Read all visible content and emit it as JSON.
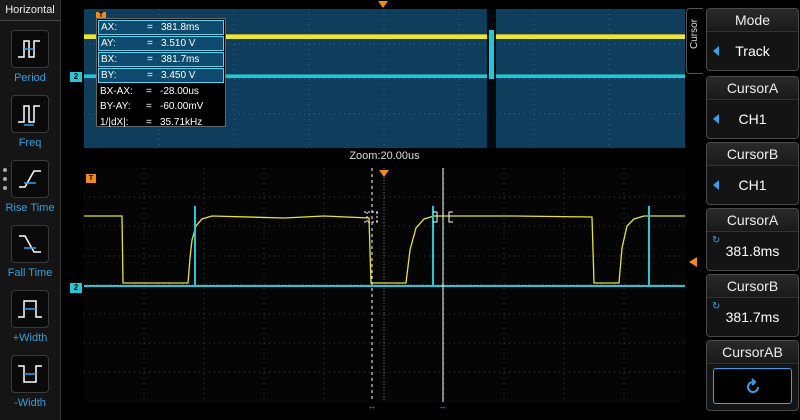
{
  "sidebar": {
    "title": "Horizontal",
    "items": [
      {
        "label": "Period",
        "icon": "period-icon"
      },
      {
        "label": "Freq",
        "icon": "frequency-icon"
      },
      {
        "label": "Rise Time",
        "icon": "rise-time-icon"
      },
      {
        "label": "Fall Time",
        "icon": "fall-time-icon"
      },
      {
        "label": "+Width",
        "icon": "positive-width-icon"
      },
      {
        "label": "-Width",
        "icon": "negative-width-icon"
      }
    ]
  },
  "measurements": [
    {
      "key": "AX:",
      "eq": "=",
      "value": "381.8ms",
      "selected": true
    },
    {
      "key": "AY:",
      "eq": "=",
      "value": "3.510 V",
      "selected": true
    },
    {
      "key": "BX:",
      "eq": "=",
      "value": "381.7ms",
      "selected": true
    },
    {
      "key": "BY:",
      "eq": "=",
      "value": "3.450 V",
      "selected": true
    },
    {
      "key": "BX-AX:",
      "eq": "=",
      "value": "-28.00us",
      "selected": false
    },
    {
      "key": "BY-AY:",
      "eq": "=",
      "value": "-60.00mV",
      "selected": false
    },
    {
      "key": "1/|dX|:",
      "eq": "=",
      "value": "35.71kHz",
      "selected": false
    }
  ],
  "zoom_label": "Zoom:20.00us",
  "markers": {
    "trigger": "T",
    "channel2": "2"
  },
  "cursor_panel": {
    "tab_label": "Cursor",
    "mode": {
      "title": "Mode",
      "value": "Track"
    },
    "cursor_a_source": {
      "title": "CursorA",
      "value": "CH1"
    },
    "cursor_b_source": {
      "title": "CursorB",
      "value": "CH1"
    },
    "cursor_a_pos": {
      "title": "CursorA",
      "value": "381.8ms"
    },
    "cursor_b_pos": {
      "title": "CursorB",
      "value": "381.7ms"
    },
    "cursor_ab": {
      "title": "CursorAB",
      "icon": "rotate-icon"
    }
  },
  "colors": {
    "ch1": "#f2f03a",
    "ch2": "#22c8d8",
    "accent": "#3aa0e8",
    "marker": "#f08a1c",
    "overview_bg": "#0f3e5d"
  }
}
